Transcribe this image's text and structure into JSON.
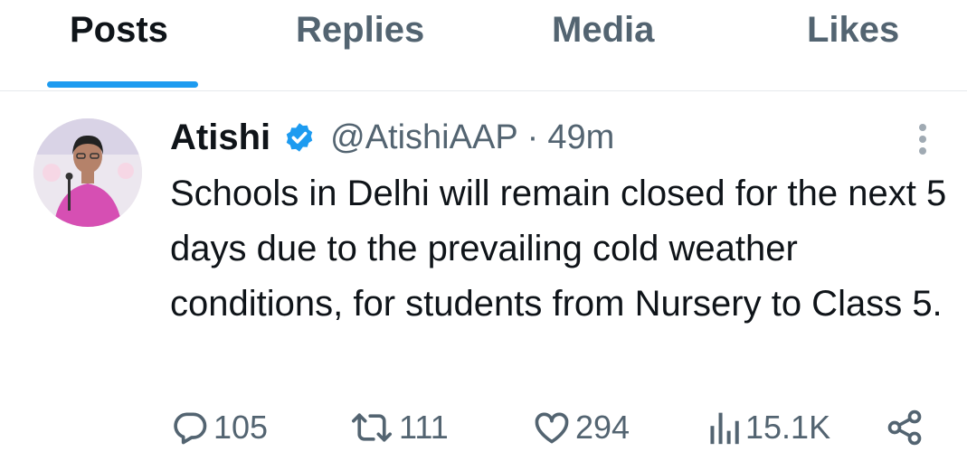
{
  "tabs": [
    {
      "label": "Posts",
      "active": true
    },
    {
      "label": "Replies",
      "active": false
    },
    {
      "label": "Media",
      "active": false
    },
    {
      "label": "Likes",
      "active": false
    }
  ],
  "post": {
    "author_name": "Atishi",
    "handle": "@AtishiAAP",
    "separator": "·",
    "time": "49m",
    "verified": true,
    "text": "Schools in Delhi will remain closed for the next 5 days due to the prevailing cold weather conditions, for students from Nursery to Class 5.",
    "actions": {
      "replies": "105",
      "reposts": "111",
      "likes": "294",
      "views": "15.1K"
    }
  },
  "colors": {
    "accent": "#1d9bf0",
    "text_primary": "#0f1419",
    "text_secondary": "#536471",
    "divider": "#e6e9ec"
  },
  "icons": [
    "verified-badge-icon",
    "more-vertical-icon",
    "reply-icon",
    "repost-icon",
    "like-icon",
    "views-icon",
    "share-icon"
  ]
}
